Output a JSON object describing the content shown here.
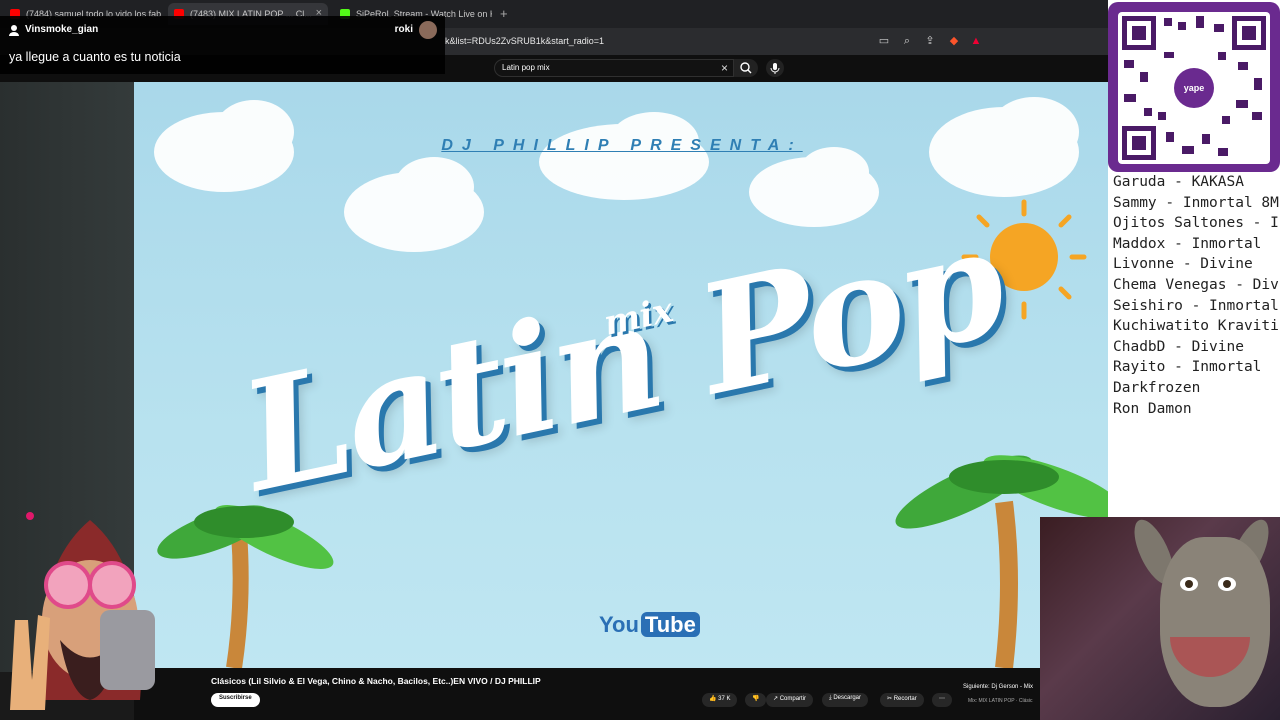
{
  "tabs": [
    {
      "label": "(7484) samuel todo lo vido los fab...",
      "color": "#ff0000"
    },
    {
      "label": "(7483) MIX LATIN POP ... Cl...",
      "color": "#ff0000"
    },
    {
      "label": "SiPeRoL Stream - Watch Live on Kick",
      "color": "#53fc18"
    }
  ],
  "url": "k&list=RDUs2ZvSRUB1k&start_radio=1",
  "search": {
    "value": "Latin pop mix"
  },
  "chat": {
    "username": "Vinsmoke_gian",
    "message": "ya llegue a cuanto es tu noticia",
    "right_user": "roki"
  },
  "video": {
    "header": "DJ PHILLIP PRESENTA:",
    "big_title": "Latin Pop",
    "mix": "mix",
    "logo_you": "You",
    "logo_tube": "Tube",
    "title": "Clásicos (Lil Silvio & El Vega, Chino & Nacho, Bacilos, Etc..)EN VIVO / DJ PHILLIP",
    "subscribe": "Suscribirse",
    "likes": "37 K",
    "share": "Compartir",
    "download": "Descargar",
    "clip": "Recortar",
    "next_label": "Siguiente: Dj Gerson - Mix",
    "next_sub": "Mix: MIX LATIN POP · Clásic"
  },
  "qr": {
    "brand": "yape"
  },
  "names": [
    "Garuda - KAKASA",
    "Sammy - Inmortal 8M",
    "Ojitos Saltones - I",
    "Maddox - Inmortal",
    "Livonne - Divine",
    "Chema Venegas - Div",
    "Seishiro - Inmortal",
    "Kuchiwatito Kraviti",
    "ChadbD - Divine",
    "Rayito - Inmortal",
    "Darkfrozen",
    "Ron Damon"
  ],
  "colors": {
    "accent": "#2f7fb4",
    "yape": "#6a2a8f"
  }
}
